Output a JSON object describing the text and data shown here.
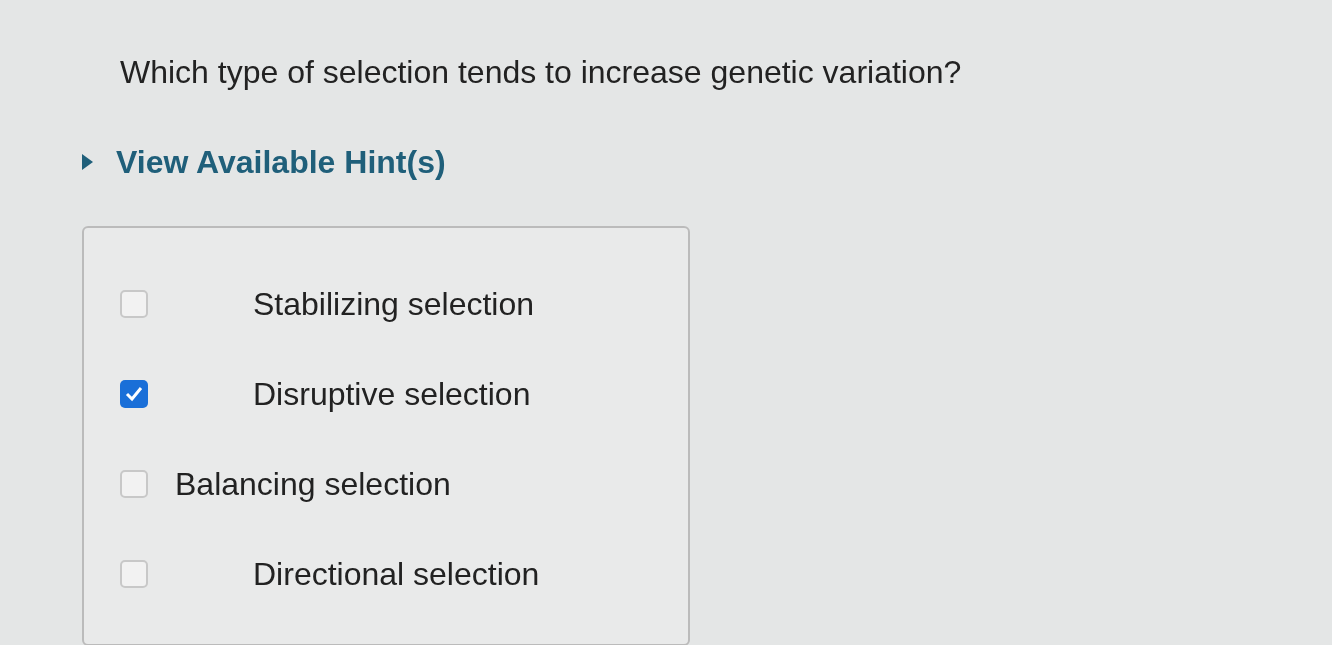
{
  "question": "Which type of selection tends to increase genetic variation?",
  "hint": {
    "label": "View Available Hint(s)",
    "expanded": false
  },
  "options": [
    {
      "label": "Stabilizing selection",
      "checked": false,
      "kind": "indented"
    },
    {
      "label": "Disruptive selection",
      "checked": true,
      "kind": "indented"
    },
    {
      "label": "Balancing selection",
      "checked": false,
      "kind": "flush"
    },
    {
      "label": "Directional selection",
      "checked": false,
      "kind": "indented"
    }
  ]
}
